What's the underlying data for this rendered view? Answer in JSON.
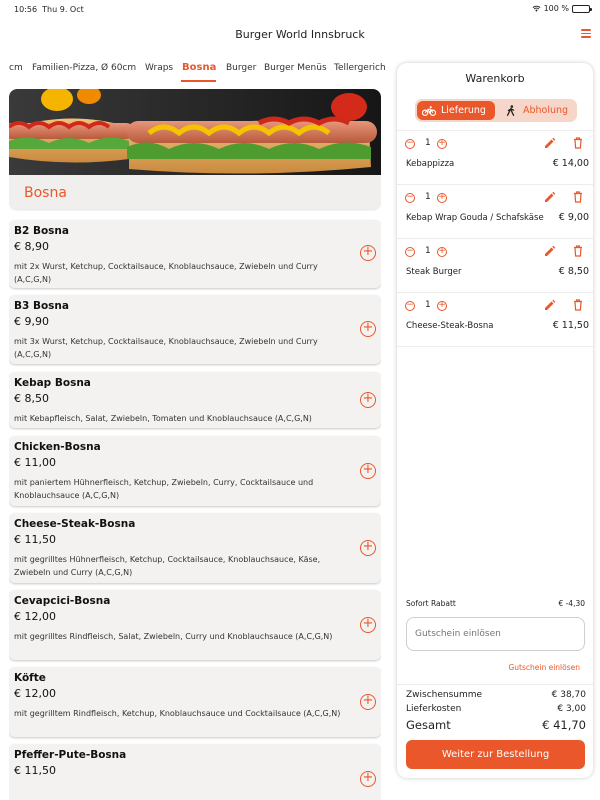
{
  "status_bar": {
    "time": "10:56",
    "date": "Thu 9. Oct",
    "battery": "100 %",
    "battery_level": 1.0
  },
  "app_title": "Burger World Innsbruck",
  "icons": {
    "menu": "menu-icon",
    "bike": "bike-icon",
    "walk": "walk-icon",
    "edit": "edit-icon",
    "trash": "trash-icon",
    "add": "plus-circle-icon"
  },
  "colors": {
    "accent": "#e9572b",
    "accent_light": "#f6d6c9",
    "card": "#f3f2f1"
  },
  "tabs": [
    {
      "label": "cm"
    },
    {
      "label": "Familien-Pizza, Ø 60cm"
    },
    {
      "label": "Wraps"
    },
    {
      "label": "Bosna",
      "active": true
    },
    {
      "label": "Burger"
    },
    {
      "label": "Burger Menüs"
    },
    {
      "label": "Tellergerich"
    }
  ],
  "category": {
    "title": "Bosna"
  },
  "products": [
    {
      "name": "B2 Bosna",
      "price": "€ 8,90",
      "description": "mit 2x Wurst, Ketchup, Cocktailsauce, Knoblauchsauce, Zwiebeln und Curry (A,C,G,N)"
    },
    {
      "name": "B3 Bosna",
      "price": "€ 9,90",
      "description": "mit 3x Wurst, Ketchup, Cocktailsauce, Knoblauchsauce, Zwiebeln und Curry (A,C,G,N)"
    },
    {
      "name": "Kebap Bosna",
      "price": "€ 8,50",
      "description": "mit Kebapfleisch, Salat, Zwiebeln, Tomaten und Knoblauchsauce (A,C,G,N)"
    },
    {
      "name": "Chicken-Bosna",
      "price": "€ 11,00",
      "description": "mit paniertem Hühnerfleisch, Ketchup, Zwiebeln, Curry, Cocktailsauce und Knoblauchsauce (A,C,G,N)"
    },
    {
      "name": "Cheese-Steak-Bosna",
      "price": "€ 11,50",
      "description": "mit gegrilltes Hühnerfleisch, Ketchup, Cocktailsauce, Knoblauchsauce, Käse, Zwiebeln und Curry (A,C,G,N)"
    },
    {
      "name": "Cevapcici-Bosna",
      "price": "€ 12,00",
      "description": "mit gegrilltes Rindfleisch, Salat, Zwiebeln, Curry und Knoblauchsauce (A,C,G,N)"
    },
    {
      "name": "Köfte",
      "price": "€ 12,00",
      "description": "mit gegrilltem Rindfleisch, Ketchup, Knoblauchsauce und Cocktailsauce (A,C,G,N)"
    },
    {
      "name": "Pfeffer-Pute-Bosna",
      "price": "€ 11,50",
      "description": ""
    }
  ],
  "cart": {
    "title": "Warenkorb",
    "delivery_label": "Lieferung",
    "pickup_label": "Abholung",
    "items": [
      {
        "qty": "1",
        "name": "Kebappizza",
        "price": "€ 14,00"
      },
      {
        "qty": "1",
        "name": "Kebap Wrap Gouda / Schafskäse",
        "price": "€ 9,00"
      },
      {
        "qty": "1",
        "name": "Steak Burger",
        "price": "€ 8,50"
      },
      {
        "qty": "1",
        "name": "Cheese-Steak-Bosna",
        "price": "€ 11,50"
      }
    ],
    "discount_label": "Sofort Rabatt",
    "discount_value": "€ -4,30",
    "voucher_placeholder": "Gutschein einlösen",
    "voucher_link": "Gutschein einlösen",
    "subtotal_label": "Zwischensumme",
    "subtotal_value": "€ 38,70",
    "delivery_cost_label": "Lieferkosten",
    "delivery_cost_value": "€ 3,00",
    "total_label": "Gesamt",
    "total_value": "€ 41,70",
    "checkout_label": "Weiter zur Bestellung"
  }
}
